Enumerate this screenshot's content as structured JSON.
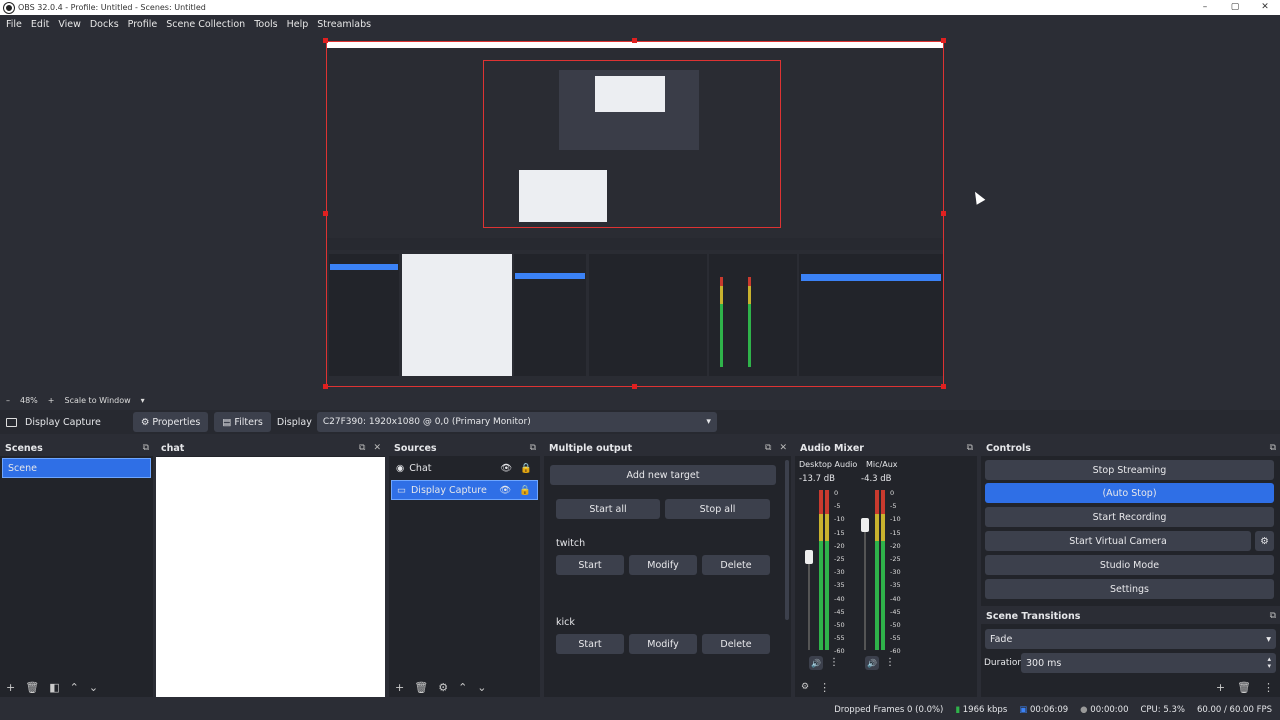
{
  "window": {
    "title": "OBS 32.0.4 - Profile: Untitled - Scenes: Untitled",
    "controls": [
      "–",
      "▢",
      "✕"
    ]
  },
  "menu": [
    "File",
    "Edit",
    "View",
    "Docks",
    "Profile",
    "Scene Collection",
    "Tools",
    "Help",
    "Streamlabs"
  ],
  "zoom": {
    "minus": "–",
    "level": "48%",
    "plus": "+",
    "mode": "Scale to Window"
  },
  "source_toolbar": {
    "source_name": "Display Capture",
    "properties": "Properties",
    "filters": "Filters",
    "display_label": "Display",
    "display_value": "C27F390: 1920x1080 @ 0,0 (Primary Monitor)"
  },
  "scenes": {
    "title": "Scenes",
    "items": [
      "Scene"
    ]
  },
  "chat": {
    "title": "chat"
  },
  "sources": {
    "title": "Sources",
    "items": [
      "Chat",
      "Display Capture"
    ]
  },
  "multiple_output": {
    "title": "Multiple output",
    "add_target": "Add new target",
    "start_all": "Start all",
    "stop_all": "Stop all",
    "targets": [
      {
        "name": "twitch",
        "start": "Start",
        "modify": "Modify",
        "delete": "Delete"
      },
      {
        "name": "kick",
        "start": "Start",
        "modify": "Modify",
        "delete": "Delete"
      }
    ]
  },
  "audio_mixer": {
    "title": "Audio Mixer",
    "channels": [
      {
        "name": "Desktop Audio",
        "db": "-13.7 dB",
        "level": 0.62
      },
      {
        "name": "Mic/Aux",
        "db": "-4.3 dB",
        "level": 0.8
      }
    ],
    "scale": [
      "0",
      "-5",
      "-10",
      "-15",
      "-20",
      "-25",
      "-30",
      "-35",
      "-40",
      "-45",
      "-50",
      "-55",
      "-60"
    ]
  },
  "controls": {
    "title": "Controls",
    "stop_streaming": "Stop Streaming",
    "auto_stop": "(Auto Stop)",
    "start_recording": "Start Recording",
    "start_virtual_camera": "Start Virtual Camera",
    "studio_mode": "Studio Mode",
    "settings": "Settings"
  },
  "scene_transitions": {
    "title": "Scene Transitions",
    "transition": "Fade",
    "duration_label": "Duration",
    "duration_value": "300 ms"
  },
  "status": {
    "dropped_frames": "Dropped Frames 0 (0.0%)",
    "bitrate": "1966 kbps",
    "stream_time": "00:06:09",
    "record_time": "00:00:00",
    "cpu": "CPU: 5.3%",
    "fps": "60.00 / 60.00 FPS"
  },
  "colors": {
    "accent": "#2f6fe6",
    "selection_border": "#e02020",
    "panel_bg": "#22242a",
    "meter_green": "#2fb34a",
    "meter_yellow": "#c9b22e",
    "meter_red": "#c93a2e"
  }
}
